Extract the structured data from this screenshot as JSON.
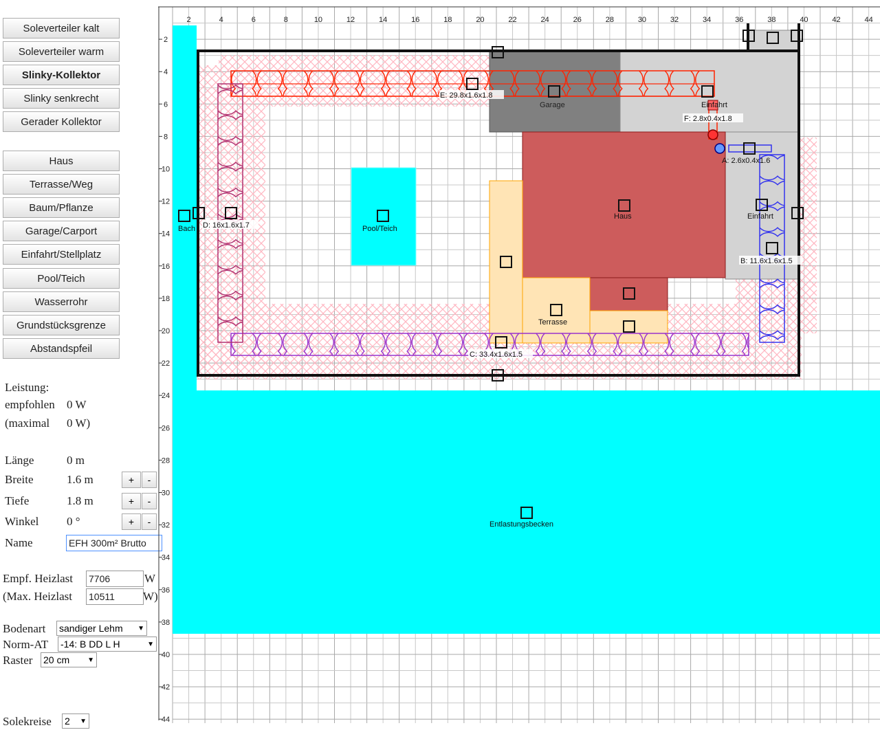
{
  "toolbar_group1": [
    {
      "label": "Soleverteiler kalt",
      "active": false
    },
    {
      "label": "Soleverteiler warm",
      "active": false
    },
    {
      "label": "Slinky-Kollektor",
      "active": true
    },
    {
      "label": "Slinky senkrecht",
      "active": false
    },
    {
      "label": "Gerader Kollektor",
      "active": false
    }
  ],
  "toolbar_group2": [
    {
      "label": "Haus"
    },
    {
      "label": "Terrasse/Weg"
    },
    {
      "label": "Baum/Pflanze"
    },
    {
      "label": "Garage/Carport"
    },
    {
      "label": "Einfahrt/Stellplatz"
    },
    {
      "label": "Pool/Teich"
    },
    {
      "label": "Wasserrohr"
    },
    {
      "label": "Grundstücksgrenze"
    },
    {
      "label": "Abstandspfeil"
    }
  ],
  "leistung": {
    "title": "Leistung:",
    "empfohlen_label": "empfohlen",
    "empfohlen_value": "0 W",
    "maximal_label": "(maximal",
    "maximal_value": "0 W)"
  },
  "props": {
    "laenge_label": "Länge",
    "laenge_value": "0 m",
    "breite_label": "Breite",
    "breite_value": "1.6 m",
    "tiefe_label": "Tiefe",
    "tiefe_value": "1.8 m",
    "winkel_label": "Winkel",
    "winkel_value": "0 °",
    "plus": "+",
    "minus": "-",
    "name_label": "Name",
    "name_value": "EFH 300m² Brutto"
  },
  "heizlast": {
    "empf_label": "Empf. Heizlast",
    "empf_value": "7706",
    "empf_unit": "W",
    "max_label": "(Max. Heizlast",
    "max_value": "10511",
    "max_unit": "W)"
  },
  "settings": {
    "bodenart_label": "Bodenart",
    "bodenart_value": "sandiger Lehm",
    "normat_label": "Norm-AT",
    "normat_value": "-14: B DD L H",
    "raster_label": "Raster",
    "raster_value": "20 cm",
    "solekreise_label": "Solekreise",
    "solekreise_value": "2"
  },
  "plan": {
    "xticks": [
      "2",
      "4",
      "6",
      "8",
      "10",
      "12",
      "14",
      "16",
      "18",
      "20",
      "22",
      "24",
      "26",
      "28",
      "30",
      "32",
      "34",
      "36",
      "38",
      "40",
      "42",
      "44"
    ],
    "yticks": [
      "2",
      "4",
      "6",
      "8",
      "10",
      "12",
      "14",
      "16",
      "18",
      "20",
      "22",
      "24",
      "26",
      "28",
      "30",
      "32",
      "34",
      "36",
      "38",
      "40",
      "42",
      "44"
    ],
    "objects": {
      "bach": "Bach",
      "pool": "Pool/Teich",
      "garage": "Garage",
      "einfahrt_top": "Einfahrt",
      "haus": "Haus",
      "einfahrt_right": "Einfahrt",
      "terrasse": "Terrasse",
      "entlastung": "Entlastungsbecken"
    },
    "collectors": {
      "a": "A: 2.6x0.4x1.6",
      "b": "B: 11.6x1.6x1.5",
      "c": "C: 33.4x1.6x1.5",
      "d": "D: 16x1.6x1.7",
      "e": "E: 29.8x1.6x1.8",
      "f": "F: 2.8x0.4x1.8"
    }
  },
  "colors": {
    "water": "#00ffff",
    "haus": "#cd5c5c",
    "garage": "#808080",
    "einfahrt": "#d3d3d3",
    "terrasse": "#ffe4b5",
    "collector_e": "#ff2200",
    "collector_c": "#9932cc",
    "collector_d": "#b03070",
    "collector_b": "#3333ee",
    "halo": "#ffb6c1"
  }
}
